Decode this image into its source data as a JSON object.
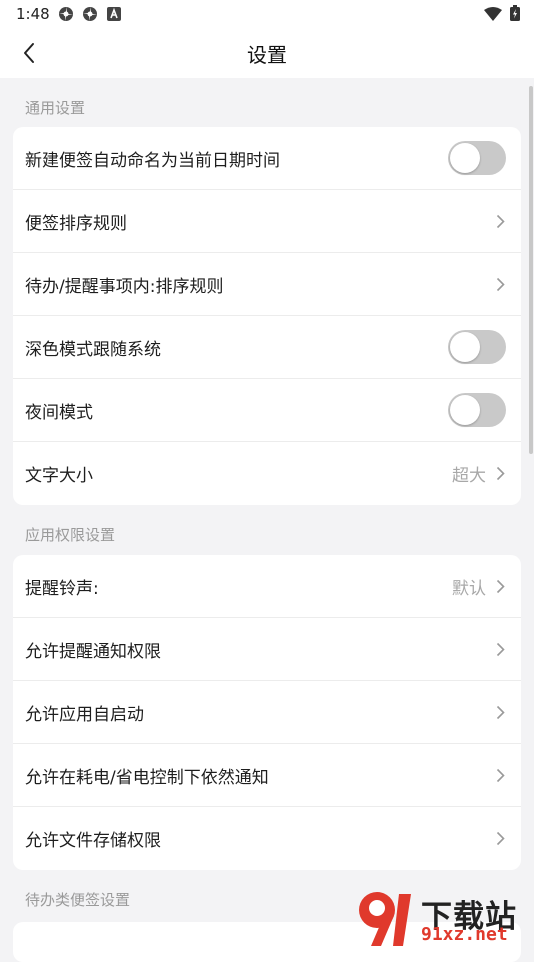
{
  "status": {
    "time": "1:48",
    "icons": [
      "settings-wheel-icon",
      "settings-wheel-icon",
      "font-a-icon"
    ],
    "right_icons": [
      "wifi-icon",
      "battery-charging-icon"
    ]
  },
  "header": {
    "title": "设置",
    "back_icon": "back-arrow-icon"
  },
  "sections": [
    {
      "title": "通用设置",
      "rows": [
        {
          "label": "新建便签自动命名为当前日期时间",
          "control": "toggle",
          "on": false
        },
        {
          "label": "便签排序规则",
          "control": "chevron"
        },
        {
          "label": "待办/提醒事项内:排序规则",
          "control": "chevron"
        },
        {
          "label": "深色模式跟随系统",
          "control": "toggle",
          "on": false
        },
        {
          "label": "夜间模式",
          "control": "toggle",
          "on": false
        },
        {
          "label": "文字大小",
          "value": "超大",
          "control": "chevron"
        }
      ]
    },
    {
      "title": "应用权限设置",
      "rows": [
        {
          "label": "提醒铃声:",
          "value": "默认",
          "control": "chevron"
        },
        {
          "label": "允许提醒通知权限",
          "control": "chevron"
        },
        {
          "label": "允许应用自启动",
          "control": "chevron"
        },
        {
          "label": "允许在耗电/省电控制下依然通知",
          "control": "chevron"
        },
        {
          "label": "允许文件存储权限",
          "control": "chevron"
        }
      ]
    },
    {
      "title": "待办类便签设置"
    }
  ],
  "watermark": {
    "text": "下载站",
    "url": "91xz.net",
    "logo": "91-logo-icon"
  },
  "colors": {
    "background": "#f3f3f5",
    "card": "#ffffff",
    "toggle_off": "#c9c9c9",
    "watermark_red": "#e0392c"
  }
}
